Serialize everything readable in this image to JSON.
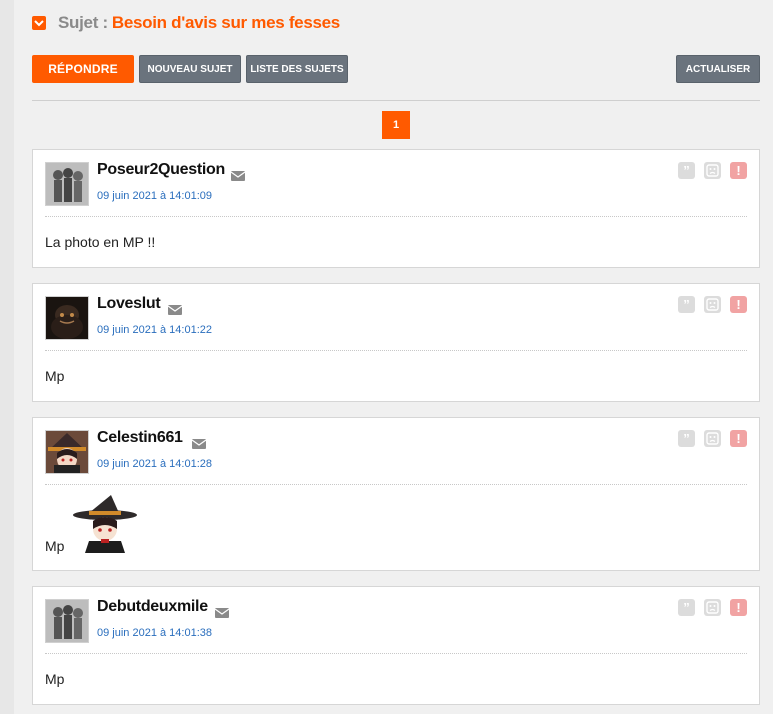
{
  "topic": {
    "prefix": "Sujet :",
    "title": "Besoin d'avis sur mes fesses"
  },
  "toolbar": {
    "reply_label": "RÉPONDRE",
    "new_topic_label": "NOUVEAU SUJET",
    "topic_list_label": "LISTE DES SUJETS",
    "refresh_label": "ACTUALISER"
  },
  "pagination": {
    "current_page": "1"
  },
  "posts": [
    {
      "author": "Poseur2Question",
      "date": "09 juin 2021 à 14:01:09",
      "content": "La photo en MP !!",
      "avatar": "default-silhouettes"
    },
    {
      "author": "Loveslut",
      "date": "09 juin 2021 à 14:01:22",
      "content": "Mp",
      "avatar": "dark-character"
    },
    {
      "author": "Celestin661",
      "date": "09 juin 2021 à 14:01:28",
      "content": "Mp",
      "avatar": "anime-witch",
      "sticker": "anime-witch-sticker"
    },
    {
      "author": "Debutdeuxmile",
      "date": "09 juin 2021 à 14:01:38",
      "content": "Mp",
      "avatar": "default-silhouettes"
    }
  ],
  "icons": {
    "quote": "quote-icon",
    "mp": "envelope-icon",
    "smiley": "sad-smiley-icon",
    "report": "report-icon"
  },
  "colors": {
    "accent": "#ff5a00",
    "button_grey": "#6a737d",
    "date_link": "#2a6ebd",
    "report": "#f1a3a3"
  }
}
